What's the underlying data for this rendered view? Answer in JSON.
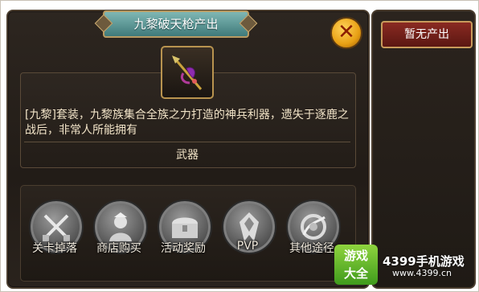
{
  "dialog": {
    "title": "九黎破天枪产出",
    "close_icon": "close-icon",
    "item_icon": "spear-icon",
    "description": "[九黎]套装，九黎族集合全族之力打造的神兵利器，遗失于逐鹿之战后，非常人所能拥有",
    "item_type": "武器"
  },
  "sources": [
    {
      "label": "关卡掉落",
      "icon": "crossed-swords-icon"
    },
    {
      "label": "商店购买",
      "icon": "merchant-icon"
    },
    {
      "label": "活动奖励",
      "icon": "treasure-chest-icon"
    },
    {
      "label": "PVP",
      "icon": "pvp-emblem-icon"
    },
    {
      "label": "其他途径",
      "icon": "wing-shield-icon"
    }
  ],
  "right_panel": {
    "button_label": "暂无产出"
  },
  "watermark": {
    "logo_line1": "游戏",
    "logo_line2": "大全",
    "brand": "4399手机游戏",
    "url": "www.4399.cn"
  },
  "colors": {
    "accent_gold": "#b8934f",
    "title_teal": "#5e9a98",
    "button_red": "#7a231c"
  }
}
